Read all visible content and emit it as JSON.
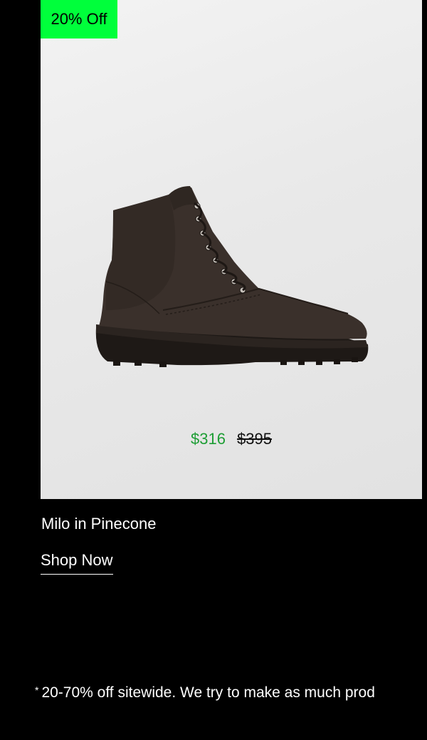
{
  "promo": {
    "badge": "20% Off"
  },
  "product": {
    "name": "Milo in Pinecone",
    "sale_price": "$316",
    "original_price": "$395",
    "image_icon": "lace-up-boot-image"
  },
  "cta": {
    "label": "Shop Now"
  },
  "footnote": {
    "star": "*",
    "text": "20-70% off sitewide. We try to make as much prod"
  },
  "colors": {
    "background": "#000000",
    "badge": "#00ff3b",
    "sale_price": "#1e9e35"
  }
}
